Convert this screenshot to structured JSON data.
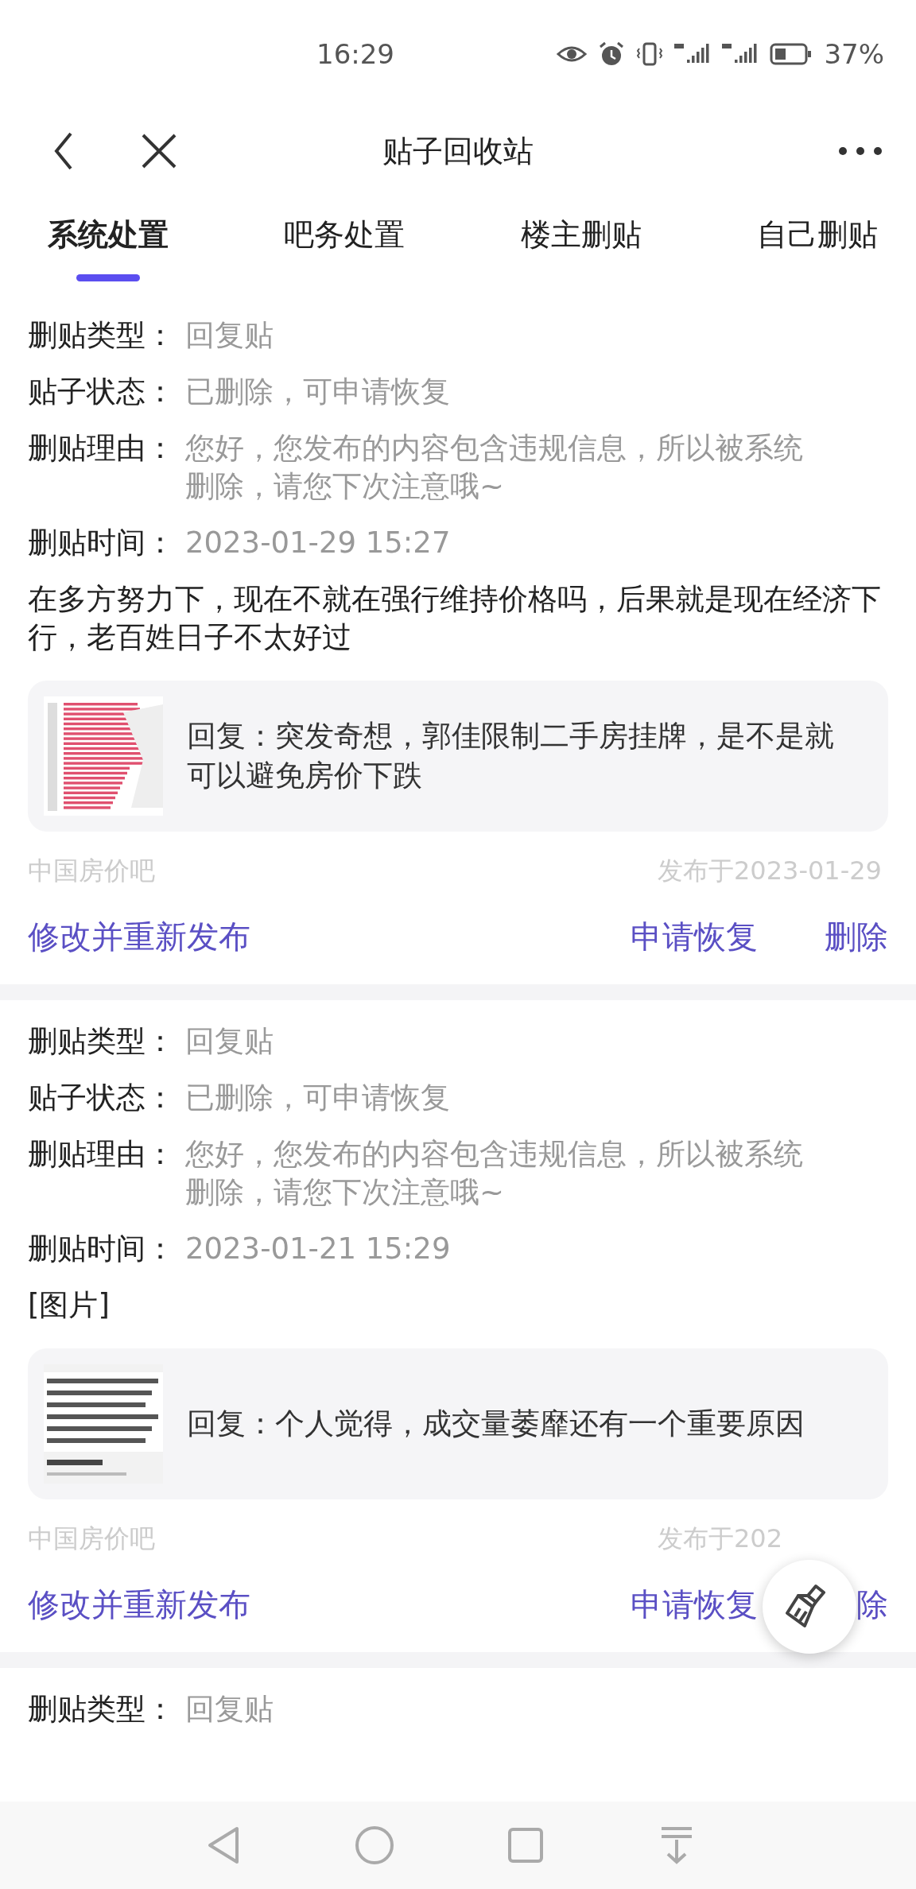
{
  "status_bar": {
    "time": "16:29",
    "battery": "37%"
  },
  "header": {
    "title": "贴子回收站"
  },
  "tabs": [
    {
      "label": "系统处置",
      "selected": true
    },
    {
      "label": "吧务处置",
      "selected": false
    },
    {
      "label": "楼主删贴",
      "selected": false
    },
    {
      "label": "自己删贴",
      "selected": false
    }
  ],
  "posts": [
    {
      "fields": [
        {
          "label": "删贴类型：",
          "value": "回复贴"
        },
        {
          "label": "贴子状态：",
          "value": "已删除，可申请恢复"
        },
        {
          "label": "删贴理由：",
          "value": "您好，您发布的内容包含违规信息，所以被系统删除，请您下次注意哦~"
        },
        {
          "label": "删贴时间：",
          "value": "2023-01-29 15:27"
        }
      ],
      "content": "在多方努力下，现在不就在强行维持价格吗，后果就是现在经济下行，老百姓日子不太好过",
      "quote": {
        "text": "回复：突发奇想，郭佳限制二手房挂牌，是不是就可以避免房价下跌"
      },
      "forum": "中国房价吧",
      "date": "发布于2023-01-29",
      "actions": {
        "edit": "修改并重新发布",
        "restore": "申请恢复",
        "delete": "删除"
      }
    },
    {
      "fields": [
        {
          "label": "删贴类型：",
          "value": "回复贴"
        },
        {
          "label": "贴子状态：",
          "value": "已删除，可申请恢复"
        },
        {
          "label": "删贴理由：",
          "value": "您好，您发布的内容包含违规信息，所以被系统删除，请您下次注意哦~"
        },
        {
          "label": "删贴时间：",
          "value": "2023-01-21 15:29"
        }
      ],
      "content": "[图片]",
      "quote": {
        "text": "回复：个人觉得，成交量萎靡还有一个重要原因"
      },
      "forum": "中国房价吧",
      "date": "发布于202",
      "actions": {
        "edit": "修改并重新发布",
        "restore": "申请恢复",
        "delete": "除"
      }
    },
    {
      "fields": [
        {
          "label": "删贴类型：",
          "value": "回复贴"
        }
      ]
    }
  ]
}
